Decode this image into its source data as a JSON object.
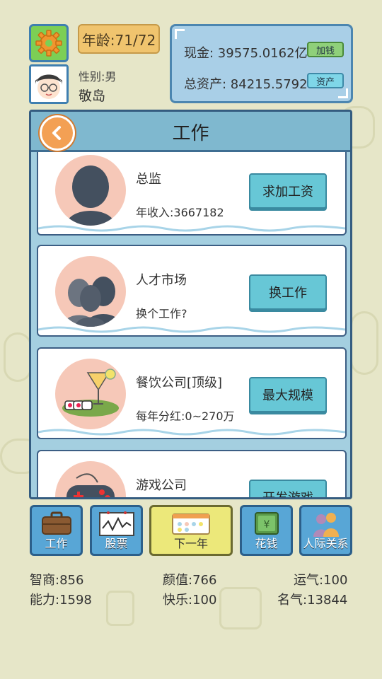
{
  "player": {
    "age_text": "年龄:71/72",
    "gender_text": "性别:男",
    "name": "敬岛"
  },
  "money": {
    "cash_text": "现金: 39575.0162亿",
    "add_money_label": "加钱",
    "assets_text": "总资产: 84215.5792亿",
    "assets_button_label": "资产"
  },
  "work_panel": {
    "title": "工作",
    "cards": [
      {
        "title": "总监",
        "subtitle": "年收入:3667182",
        "button": "求加工资",
        "icon": "person-silhouette-icon"
      },
      {
        "title": "人才市场",
        "subtitle": "换个工作?",
        "button": "换工作",
        "icon": "people-silhouette-icon"
      },
      {
        "title": "餐饮公司[顶级]",
        "subtitle": "每年分红:0~270万",
        "button": "最大规模",
        "icon": "cocktail-sushi-icon"
      },
      {
        "title": "游戏公司",
        "subtitle": "",
        "button": "开发游戏",
        "icon": "gamepad-icon"
      }
    ]
  },
  "nav": {
    "work": "工作",
    "stocks": "股票",
    "next_year": "下一年",
    "spend": "花钱",
    "relations": "人际关系"
  },
  "stats": {
    "iq": "智商:856",
    "looks": "颜值:766",
    "luck": "运气:100",
    "ability": "能力:1598",
    "happiness": "快乐:100",
    "fame": "名气:13844"
  },
  "colors": {
    "background": "#e6e6c8",
    "panel_blue": "#a4cfe0",
    "button_teal": "#67c7d6",
    "nav_blue": "#58a6d6",
    "next_year_yellow": "#ece87a",
    "settings_green": "#7ccf55",
    "back_orange": "#f3a054"
  }
}
